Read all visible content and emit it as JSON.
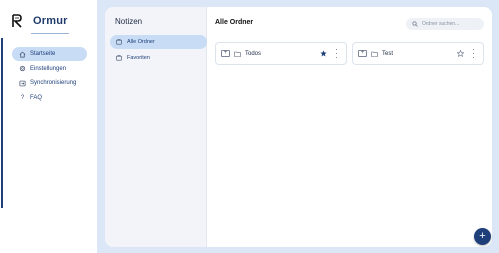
{
  "app": {
    "name": "Ormur"
  },
  "sidebar": {
    "items": [
      {
        "label": "Startseite",
        "icon": "home-icon",
        "active": true
      },
      {
        "label": "Einstellungen",
        "icon": "gear-icon",
        "active": false
      },
      {
        "label": "Synchronisierung",
        "icon": "sync-icon",
        "active": false
      },
      {
        "label": "FAQ",
        "icon": "question-icon",
        "active": false
      }
    ]
  },
  "notes": {
    "title": "Notizen",
    "items": [
      {
        "label": "Alle Ordner",
        "icon": "folders-icon",
        "active": true
      },
      {
        "label": "Favoriten",
        "icon": "favorites-icon",
        "active": false
      }
    ]
  },
  "main": {
    "title": "Alle Ordner",
    "search": {
      "placeholder": "Ordner suchen..."
    },
    "folders": [
      {
        "name": "Todos",
        "favorite": true
      },
      {
        "name": "Test",
        "favorite": false
      }
    ]
  },
  "fab": {
    "label": "+"
  },
  "colors": {
    "accent": "#1f3f7a",
    "active_bg": "#c9dcf6",
    "page_bg": "#dbe7f7",
    "panel_bg": "#f2f4f9"
  }
}
